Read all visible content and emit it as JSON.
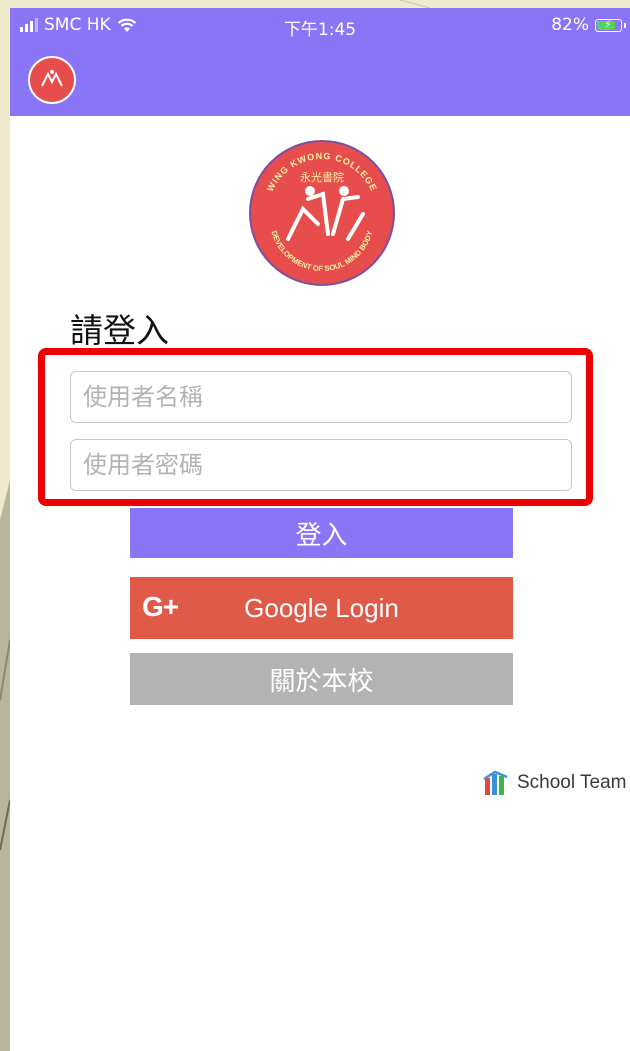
{
  "status_bar": {
    "carrier": "SMC HK",
    "time": "下午1:45",
    "battery_percent": "82%",
    "battery_level": 0.82
  },
  "app": {
    "logo_text_top": "WING KWONG COLLEGE",
    "logo_text_chinese": "永光書院",
    "logo_text_bottom": "DEVELOPMENT OF SOUL MIND BODY"
  },
  "login": {
    "title": "請登入",
    "username_placeholder": "使用者名稱",
    "password_placeholder": "使用者密碼",
    "login_label": "登入",
    "google_icon_text": "G+",
    "google_label": "Google Login",
    "about_label": "關於本校"
  },
  "footer": {
    "brand": "School Team"
  },
  "colors": {
    "primary": "#8a75f7",
    "google": "#e05a4a",
    "about": "#b3b3b3",
    "highlight": "#ee0000",
    "logo_red": "#e84d4d"
  }
}
